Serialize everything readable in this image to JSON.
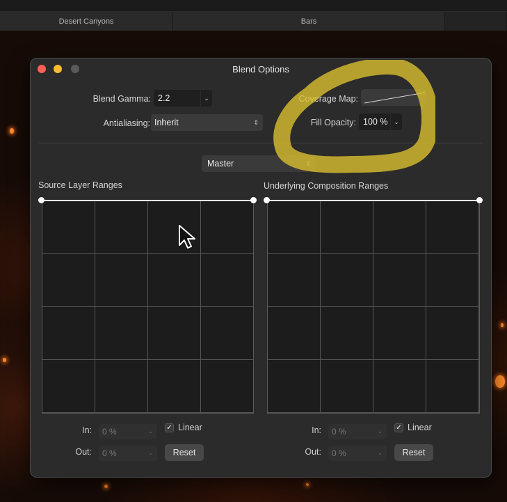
{
  "tabs": [
    "Desert Canyons",
    "Bars",
    ""
  ],
  "dialog": {
    "title": "Blend Options",
    "blend_gamma": {
      "label": "Blend Gamma:",
      "value": "2.2"
    },
    "antialiasing": {
      "label": "Antialiasing:",
      "value": "Inherit"
    },
    "coverage_map": {
      "label": "Coverage Map:"
    },
    "fill_opacity": {
      "label": "Fill Opacity:",
      "value": "100 %"
    },
    "channel": {
      "value": "Master"
    },
    "source": {
      "title": "Source Layer Ranges",
      "in_label": "In:",
      "in_value": "0 %",
      "out_label": "Out:",
      "out_value": "0 %",
      "linear_label": "Linear",
      "linear_checked": true,
      "reset_label": "Reset"
    },
    "underlying": {
      "title": "Underlying Composition Ranges",
      "in_label": "In:",
      "in_value": "0 %",
      "out_label": "Out:",
      "out_value": "0 %",
      "linear_label": "Linear",
      "linear_checked": true,
      "reset_label": "Reset"
    }
  },
  "icons": {
    "dropdown": "chevron-down-icon",
    "stepper": "up-down-arrows-icon",
    "check": "checkmark-icon",
    "pointer": "mouse-cursor-icon"
  },
  "colors": {
    "close": "#ff5f57",
    "minimize": "#febc2e",
    "highlight": "#d9bf2f",
    "dialog_bg": "#2b2b2b"
  }
}
